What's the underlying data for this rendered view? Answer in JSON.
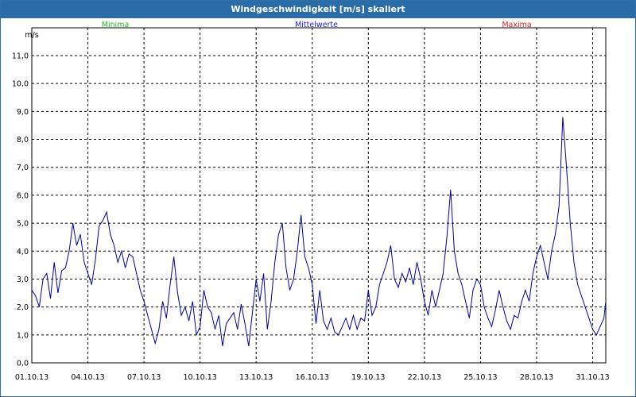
{
  "window": {
    "title": "Windgeschwindigkeit [m/s] skaliert"
  },
  "colors": {
    "titlebar": "#2a6ca8",
    "line": "#0000a0",
    "minima": "#22bb22",
    "mittelwerte": "#2222cc",
    "maxima": "#cc2222"
  },
  "chart_data": {
    "type": "line",
    "title": "Windgeschwindigkeit [m/s] skaliert",
    "ylabel": "m/s",
    "xlabel": "",
    "ylim": [
      0,
      12
    ],
    "y_ticks": [
      "0,0",
      "1,0",
      "2,0",
      "3,0",
      "4,0",
      "5,0",
      "6,0",
      "7,0",
      "8,0",
      "9,0",
      "10,0",
      "11,0"
    ],
    "x_ticks": [
      "01.10.13",
      "04.10.13",
      "07.10.13",
      "10.10.13",
      "13.10.13",
      "16.10.13",
      "19.10.13",
      "22.10.13",
      "25.10.13",
      "28.10.13",
      "31.10.13"
    ],
    "x_range_days": [
      0,
      30.7
    ],
    "grid": true,
    "legend": [
      "Minima",
      "Mittelwerte",
      "Maxima"
    ],
    "series": [
      {
        "name": "Mittelwerte",
        "day_values": [
          [
            0.0,
            2.6
          ],
          [
            0.2,
            2.4
          ],
          [
            0.4,
            2.0
          ],
          [
            0.6,
            3.0
          ],
          [
            0.8,
            3.2
          ],
          [
            1.0,
            2.3
          ],
          [
            1.2,
            3.6
          ],
          [
            1.4,
            2.5
          ],
          [
            1.6,
            3.3
          ],
          [
            1.8,
            3.4
          ],
          [
            2.0,
            4.0
          ],
          [
            2.2,
            5.0
          ],
          [
            2.4,
            4.2
          ],
          [
            2.6,
            4.6
          ],
          [
            2.8,
            3.6
          ],
          [
            3.0,
            3.2
          ],
          [
            3.2,
            2.8
          ],
          [
            3.4,
            3.7
          ],
          [
            3.6,
            4.9
          ],
          [
            3.8,
            5.1
          ],
          [
            4.0,
            5.4
          ],
          [
            4.2,
            4.6
          ],
          [
            4.4,
            4.2
          ],
          [
            4.6,
            3.6
          ],
          [
            4.8,
            4.0
          ],
          [
            5.0,
            3.4
          ],
          [
            5.2,
            3.9
          ],
          [
            5.4,
            3.8
          ],
          [
            5.6,
            3.2
          ],
          [
            5.8,
            2.6
          ],
          [
            6.0,
            2.2
          ],
          [
            6.2,
            1.7
          ],
          [
            6.4,
            1.2
          ],
          [
            6.6,
            0.7
          ],
          [
            6.8,
            1.2
          ],
          [
            7.0,
            2.2
          ],
          [
            7.2,
            1.6
          ],
          [
            7.4,
            2.8
          ],
          [
            7.6,
            3.8
          ],
          [
            7.8,
            2.5
          ],
          [
            8.0,
            1.7
          ],
          [
            8.2,
            2.0
          ],
          [
            8.4,
            1.5
          ],
          [
            8.6,
            2.2
          ],
          [
            8.8,
            1.0
          ],
          [
            9.0,
            1.3
          ],
          [
            9.2,
            2.6
          ],
          [
            9.4,
            2.0
          ],
          [
            9.6,
            1.8
          ],
          [
            9.8,
            1.2
          ],
          [
            10.0,
            1.7
          ],
          [
            10.2,
            0.6
          ],
          [
            10.4,
            1.4
          ],
          [
            10.6,
            1.6
          ],
          [
            10.8,
            1.8
          ],
          [
            11.0,
            1.2
          ],
          [
            11.2,
            2.1
          ],
          [
            11.4,
            1.4
          ],
          [
            11.6,
            0.6
          ],
          [
            11.8,
            1.8
          ],
          [
            12.0,
            3.0
          ],
          [
            12.2,
            2.2
          ],
          [
            12.4,
            3.2
          ],
          [
            12.6,
            1.2
          ],
          [
            12.8,
            2.2
          ],
          [
            13.0,
            3.6
          ],
          [
            13.2,
            4.6
          ],
          [
            13.4,
            5.0
          ],
          [
            13.6,
            3.4
          ],
          [
            13.8,
            2.6
          ],
          [
            14.0,
            3.0
          ],
          [
            14.2,
            4.0
          ],
          [
            14.4,
            5.3
          ],
          [
            14.6,
            3.8
          ],
          [
            14.8,
            3.4
          ],
          [
            15.0,
            2.8
          ],
          [
            15.2,
            1.4
          ],
          [
            15.4,
            2.6
          ],
          [
            15.6,
            1.5
          ],
          [
            15.8,
            1.2
          ],
          [
            16.0,
            1.6
          ],
          [
            16.2,
            1.1
          ],
          [
            16.4,
            1.0
          ],
          [
            16.6,
            1.3
          ],
          [
            16.8,
            1.6
          ],
          [
            17.0,
            1.2
          ],
          [
            17.2,
            1.7
          ],
          [
            17.4,
            1.2
          ],
          [
            17.6,
            1.6
          ],
          [
            17.8,
            1.5
          ],
          [
            18.0,
            2.6
          ],
          [
            18.2,
            1.7
          ],
          [
            18.4,
            2.0
          ],
          [
            18.6,
            2.8
          ],
          [
            18.8,
            3.2
          ],
          [
            19.0,
            3.6
          ],
          [
            19.2,
            4.2
          ],
          [
            19.4,
            3.0
          ],
          [
            19.6,
            2.7
          ],
          [
            19.8,
            3.2
          ],
          [
            20.0,
            2.9
          ],
          [
            20.2,
            3.4
          ],
          [
            20.4,
            2.8
          ],
          [
            20.6,
            3.6
          ],
          [
            20.8,
            3.0
          ],
          [
            21.0,
            2.2
          ],
          [
            21.2,
            1.7
          ],
          [
            21.4,
            2.6
          ],
          [
            21.6,
            2.0
          ],
          [
            21.8,
            2.6
          ],
          [
            22.0,
            3.2
          ],
          [
            22.2,
            4.5
          ],
          [
            22.4,
            6.2
          ],
          [
            22.6,
            4.0
          ],
          [
            22.8,
            3.2
          ],
          [
            23.0,
            2.8
          ],
          [
            23.2,
            2.2
          ],
          [
            23.4,
            1.6
          ],
          [
            23.6,
            2.6
          ],
          [
            23.8,
            3.0
          ],
          [
            24.0,
            2.8
          ],
          [
            24.2,
            2.0
          ],
          [
            24.4,
            1.6
          ],
          [
            24.6,
            1.3
          ],
          [
            24.8,
            1.9
          ],
          [
            25.0,
            2.6
          ],
          [
            25.2,
            2.0
          ],
          [
            25.4,
            1.5
          ],
          [
            25.6,
            1.2
          ],
          [
            25.8,
            1.7
          ],
          [
            26.0,
            1.6
          ],
          [
            26.2,
            2.2
          ],
          [
            26.4,
            2.6
          ],
          [
            26.6,
            2.2
          ],
          [
            26.8,
            3.2
          ],
          [
            27.0,
            3.8
          ],
          [
            27.2,
            4.2
          ],
          [
            27.4,
            3.6
          ],
          [
            27.6,
            3.0
          ],
          [
            27.8,
            4.0
          ],
          [
            28.0,
            4.6
          ],
          [
            28.2,
            5.6
          ],
          [
            28.4,
            8.8
          ],
          [
            28.6,
            7.0
          ],
          [
            28.8,
            5.0
          ],
          [
            29.0,
            3.6
          ],
          [
            29.2,
            2.8
          ],
          [
            29.4,
            2.4
          ],
          [
            29.6,
            2.0
          ],
          [
            29.8,
            1.6
          ],
          [
            30.0,
            1.2
          ],
          [
            30.2,
            1.0
          ],
          [
            30.4,
            1.3
          ],
          [
            30.6,
            1.6
          ],
          [
            30.7,
            2.2
          ]
        ]
      }
    ]
  }
}
